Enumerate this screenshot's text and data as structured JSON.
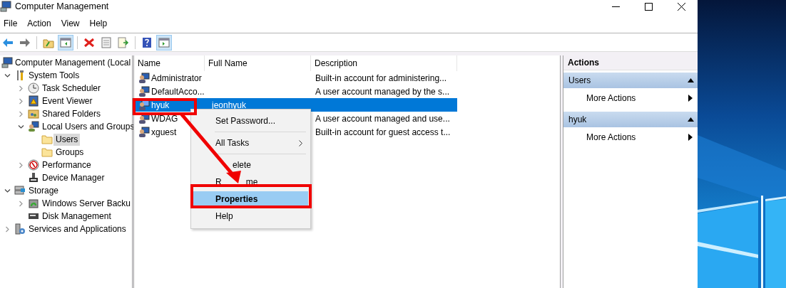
{
  "window": {
    "title": "Computer Management"
  },
  "menu": [
    "File",
    "Action",
    "View",
    "Help"
  ],
  "toolbar": [
    {
      "kind": "button",
      "pressed": false
    },
    {
      "kind": "button",
      "pressed": false
    },
    {
      "kind": "separator"
    },
    {
      "kind": "button",
      "pressed": false
    },
    {
      "kind": "button",
      "pressed": true
    },
    {
      "kind": "separator"
    },
    {
      "kind": "button",
      "pressed": false
    },
    {
      "kind": "button",
      "pressed": false
    },
    {
      "kind": "button",
      "pressed": false
    },
    {
      "kind": "separator"
    },
    {
      "kind": "button",
      "pressed": false
    },
    {
      "kind": "button",
      "pressed": true
    }
  ],
  "tree": {
    "label": "Computer Management (Local",
    "selected": false,
    "children": [
      {
        "label": "System Tools",
        "expanded": true,
        "selected": false,
        "children": [
          {
            "label": "Task Scheduler",
            "expanded": false,
            "selected": false
          },
          {
            "label": "Event Viewer",
            "expanded": false,
            "selected": false
          },
          {
            "label": "Shared Folders",
            "expanded": false,
            "selected": false
          },
          {
            "label": "Local Users and Groups",
            "expanded": true,
            "selected": false,
            "children": [
              {
                "label": "Users",
                "selected": true
              },
              {
                "label": "Groups",
                "selected": false
              }
            ]
          },
          {
            "label": "Performance",
            "expanded": false,
            "selected": false
          },
          {
            "label": "Device Manager",
            "selected": false
          }
        ]
      },
      {
        "label": "Storage",
        "expanded": true,
        "selected": false,
        "children": [
          {
            "label": "Windows Server Backu",
            "expanded": false,
            "selected": false
          },
          {
            "label": "Disk Management",
            "selected": false
          }
        ]
      },
      {
        "label": "Services and Applications",
        "expanded": false,
        "selected": false
      }
    ]
  },
  "list": {
    "columns": [
      "Name",
      "Full Name",
      "Description"
    ],
    "rows": [
      {
        "name": "Administrator",
        "description": "Built-in account for administering...",
        "selected": false
      },
      {
        "name": "DefaultAcco...",
        "description": "A user account managed by the s...",
        "selected": false
      },
      {
        "name": "hyuk",
        "full_name": "jeonhyuk",
        "selected": true
      },
      {
        "name": "WDAG",
        "description": "A user account managed and use...",
        "selected": false
      },
      {
        "name": "xguest",
        "description": "Built-in account for guest access t...",
        "selected": false
      }
    ]
  },
  "context_menu": {
    "items": [
      {
        "kind": "item",
        "label": "Set Password...",
        "selected": false,
        "default": false
      },
      {
        "kind": "separator"
      },
      {
        "kind": "submenu",
        "label": "All Tasks",
        "selected": false,
        "default": false
      },
      {
        "kind": "separator"
      },
      {
        "kind": "item",
        "label_parts": [
          "elete"
        ],
        "covered_start": true,
        "selected": false,
        "default": false
      },
      {
        "kind": "item",
        "label_parts": [
          "R",
          "me"
        ],
        "selected": false,
        "default": false
      },
      {
        "kind": "item",
        "label": "Properties",
        "selected": true,
        "default": true
      },
      {
        "kind": "item",
        "label": "Help",
        "selected": false,
        "default": false
      }
    ]
  },
  "actions": {
    "title": "Actions",
    "sections": [
      {
        "title": "Users",
        "expanded": true,
        "items": [
          "More Actions"
        ]
      },
      {
        "title": "hyuk",
        "expanded": true,
        "items": [
          "More Actions"
        ]
      }
    ]
  }
}
